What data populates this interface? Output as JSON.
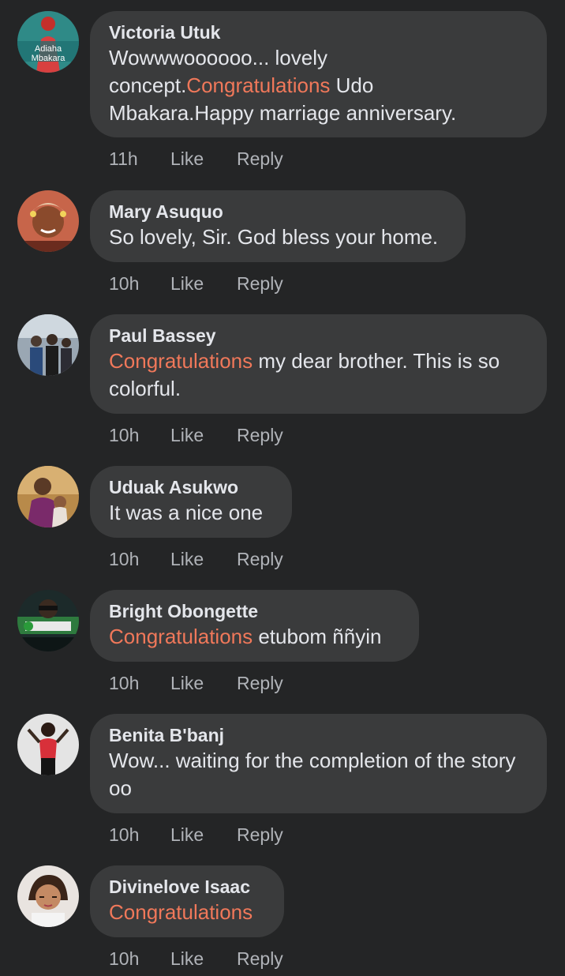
{
  "colors": {
    "background": "#242526",
    "bubble": "#3a3b3c",
    "text": "#e4e6eb",
    "secondary_text": "#b0b3b8",
    "highlight": "#f0785a"
  },
  "comments": [
    {
      "author": "Victoria Utuk",
      "avatar_text": [
        "Adiaha",
        "Mbakara"
      ],
      "text_parts": [
        {
          "t": "Wowwwoooooo... lovely "
        },
        {
          "t": "concept."
        },
        {
          "t": "Congratulations",
          "hl": true
        },
        {
          "t": " Udo "
        },
        {
          "t": "Mbakara.Happy marriage anniversary."
        }
      ],
      "time": "11h",
      "like_label": "Like",
      "reply_label": "Reply"
    },
    {
      "author": "Mary Asuquo",
      "text_parts": [
        {
          "t": "So lovely, Sir. God bless your home."
        }
      ],
      "time": "10h",
      "like_label": "Like",
      "reply_label": "Reply"
    },
    {
      "author": "Paul Bassey",
      "text_parts": [
        {
          "t": "Congratulations",
          "hl": true
        },
        {
          "t": " my dear brother. This is so colorful."
        }
      ],
      "time": "10h",
      "like_label": "Like",
      "reply_label": "Reply"
    },
    {
      "author": "Uduak Asukwo",
      "text_parts": [
        {
          "t": "It was a nice one"
        }
      ],
      "time": "10h",
      "like_label": "Like",
      "reply_label": "Reply"
    },
    {
      "author": "Bright Obongette",
      "text_parts": [
        {
          "t": "Congratulations",
          "hl": true
        },
        {
          "t": " etubom ññyin"
        }
      ],
      "time": "10h",
      "like_label": "Like",
      "reply_label": "Reply"
    },
    {
      "author": "Benita B'banj",
      "text_parts": [
        {
          "t": "Wow... waiting for the completion of the story oo"
        }
      ],
      "time": "10h",
      "like_label": "Like",
      "reply_label": "Reply"
    },
    {
      "author": "Divinelove Isaac",
      "text_parts": [
        {
          "t": "Congratulations",
          "hl": true
        }
      ],
      "time": "10h",
      "like_label": "Like",
      "reply_label": "Reply"
    }
  ]
}
